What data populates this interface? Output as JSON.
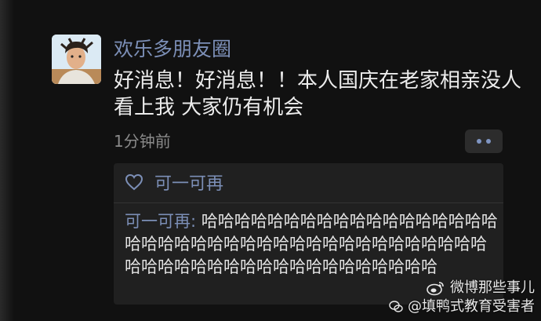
{
  "post": {
    "username": "欢乐多朋友圈",
    "text": "好消息！好消息！！本人国庆在老家相亲没人看上我 大家仍有机会",
    "timestamp": "1分钟前"
  },
  "likes": {
    "name": "可一可再"
  },
  "comment": {
    "author": "可一可再",
    "separator": ": ",
    "text": "哈哈哈哈哈哈哈哈哈哈哈哈哈哈哈哈哈哈哈哈哈哈哈哈哈哈哈哈哈哈哈哈哈哈哈哈哈哈哈哈哈哈哈哈哈哈哈哈哈哈哈哈哈哈哈哈哈哈哈"
  },
  "watermark": {
    "line1": "微博那些事儿",
    "line2": "@填鸭式教育受害者"
  },
  "colors": {
    "link": "#7c8fb7",
    "background": "#111111",
    "panel": "#202020"
  },
  "icons": [
    "heart-icon",
    "more-dots-icon",
    "weibo-icon",
    "wechat-icon"
  ]
}
